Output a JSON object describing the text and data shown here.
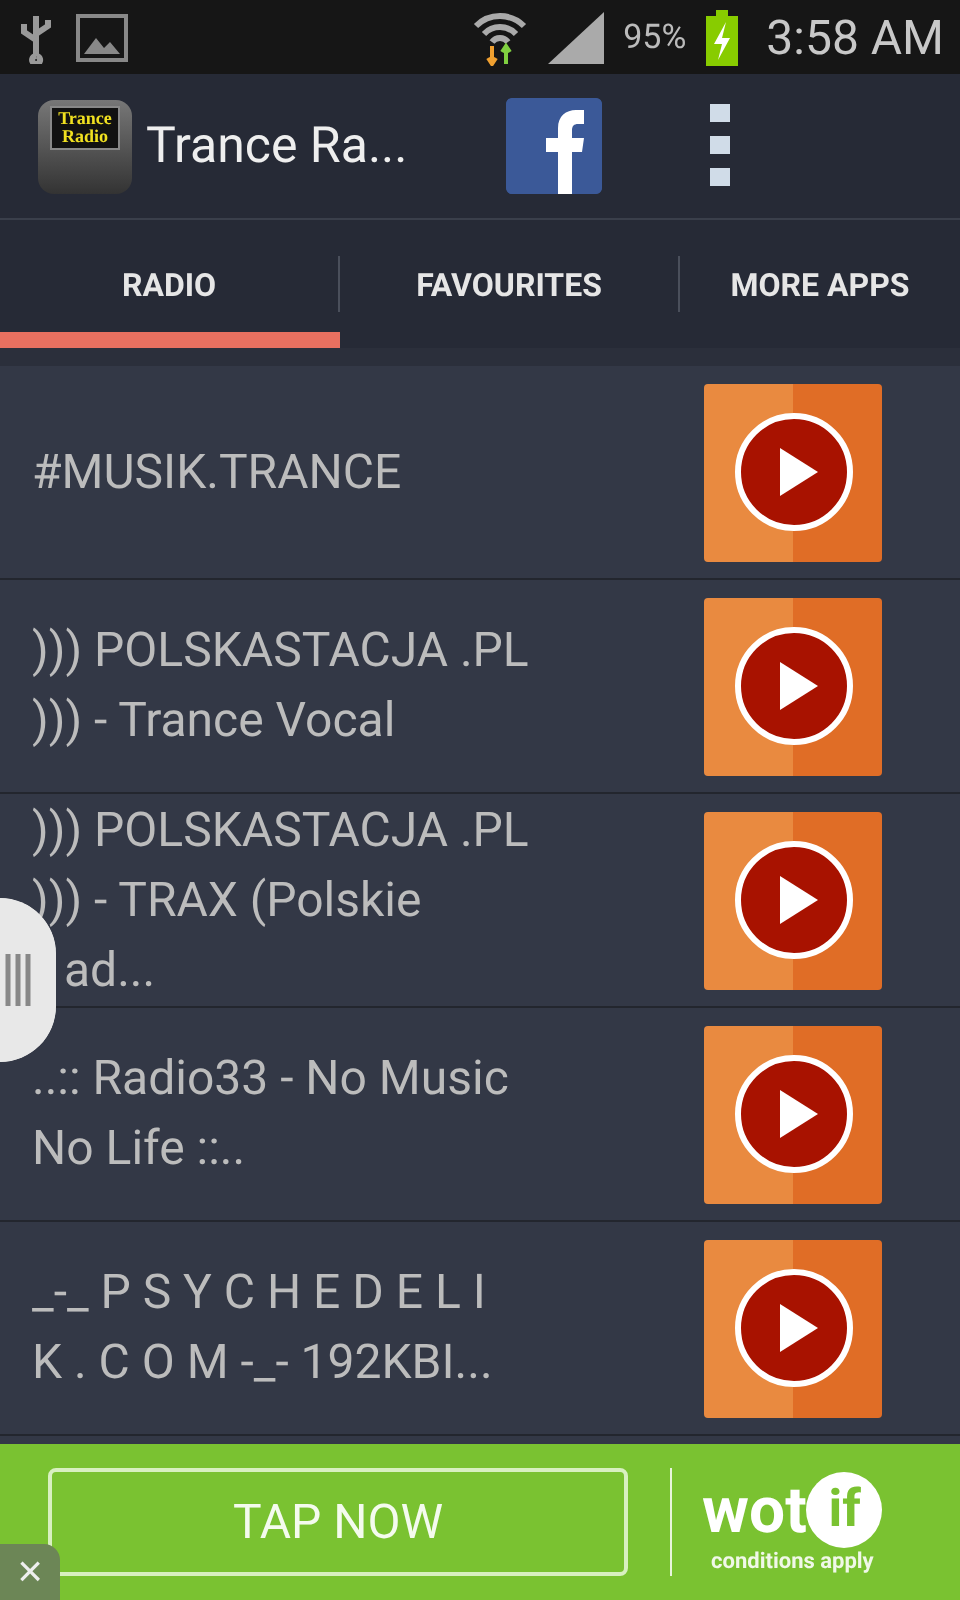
{
  "status_bar": {
    "battery": "95%",
    "time": "3:58 AM"
  },
  "app_bar": {
    "logo_text": [
      "Trance",
      "Radio"
    ],
    "title": "Trance Ra..."
  },
  "tabs": [
    {
      "label": "RADIO",
      "selected": true
    },
    {
      "label": "FAVOURITES",
      "selected": false
    },
    {
      "label": "MORE APPS",
      "selected": false
    }
  ],
  "stations": [
    {
      "lines": [
        "#MUSIK.TRANCE"
      ]
    },
    {
      "lines": [
        "))) POLSKASTACJA .PL",
        "))) - Trance Vocal"
      ]
    },
    {
      "lines": [
        "))) POLSKASTACJA .PL",
        "))) - TRAX (Polskie",
        "ad..."
      ],
      "last_line_covered": true
    },
    {
      "lines": [
        "..:: Radio33 - No Music",
        "No Life ::.."
      ]
    },
    {
      "lines": [
        "_-_ P S Y C H E D E L I",
        "K . C O M -_- 192KBI..."
      ]
    }
  ],
  "ad": {
    "button": "TAP NOW",
    "brand": [
      "wot",
      "if"
    ],
    "note": "conditions apply",
    "close": "×"
  }
}
